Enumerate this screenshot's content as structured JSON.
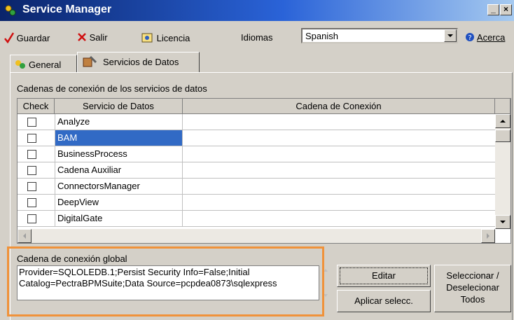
{
  "window": {
    "title": "Service Manager"
  },
  "toolbar": {
    "guardar": "Guardar",
    "salir": "Salir",
    "licencia": "Licencia",
    "idiomas": "Idiomas",
    "language_value": "Spanish",
    "acerca": "Acerca"
  },
  "tabs": [
    {
      "label": "General"
    },
    {
      "label": "Servicios de Datos"
    }
  ],
  "section_label": "Cadenas de conexión de los servicios de datos",
  "grid": {
    "columns": {
      "check": "Check",
      "servicio": "Servicio de Datos",
      "cadena": "Cadena de Conexión"
    },
    "rows": [
      {
        "servicio": "Analyze",
        "cadena": ""
      },
      {
        "servicio": "BAM",
        "cadena": ""
      },
      {
        "servicio": "BusinessProcess",
        "cadena": ""
      },
      {
        "servicio": "Cadena Auxiliar",
        "cadena": ""
      },
      {
        "servicio": "ConnectorsManager",
        "cadena": ""
      },
      {
        "servicio": "DeepView",
        "cadena": ""
      },
      {
        "servicio": "DigitalGate",
        "cadena": ""
      }
    ],
    "selected_row": "BAM"
  },
  "global": {
    "label": "Cadena de conexión global",
    "value": "Provider=SQLOLEDB.1;Persist Security Info=False;Initial\nCatalog=PectraBPMSuite;Data Source=pcpdea0873\\sqlexpress"
  },
  "buttons": {
    "editar": "Editar",
    "aplicar": "Aplicar selecc.",
    "seleccionar_l1": "Seleccionar /",
    "seleccionar_l2": "Deselecionar",
    "seleccionar_l3": "Todos"
  },
  "colors": {
    "highlight": "#316ac5",
    "callout": "#f0923a"
  }
}
